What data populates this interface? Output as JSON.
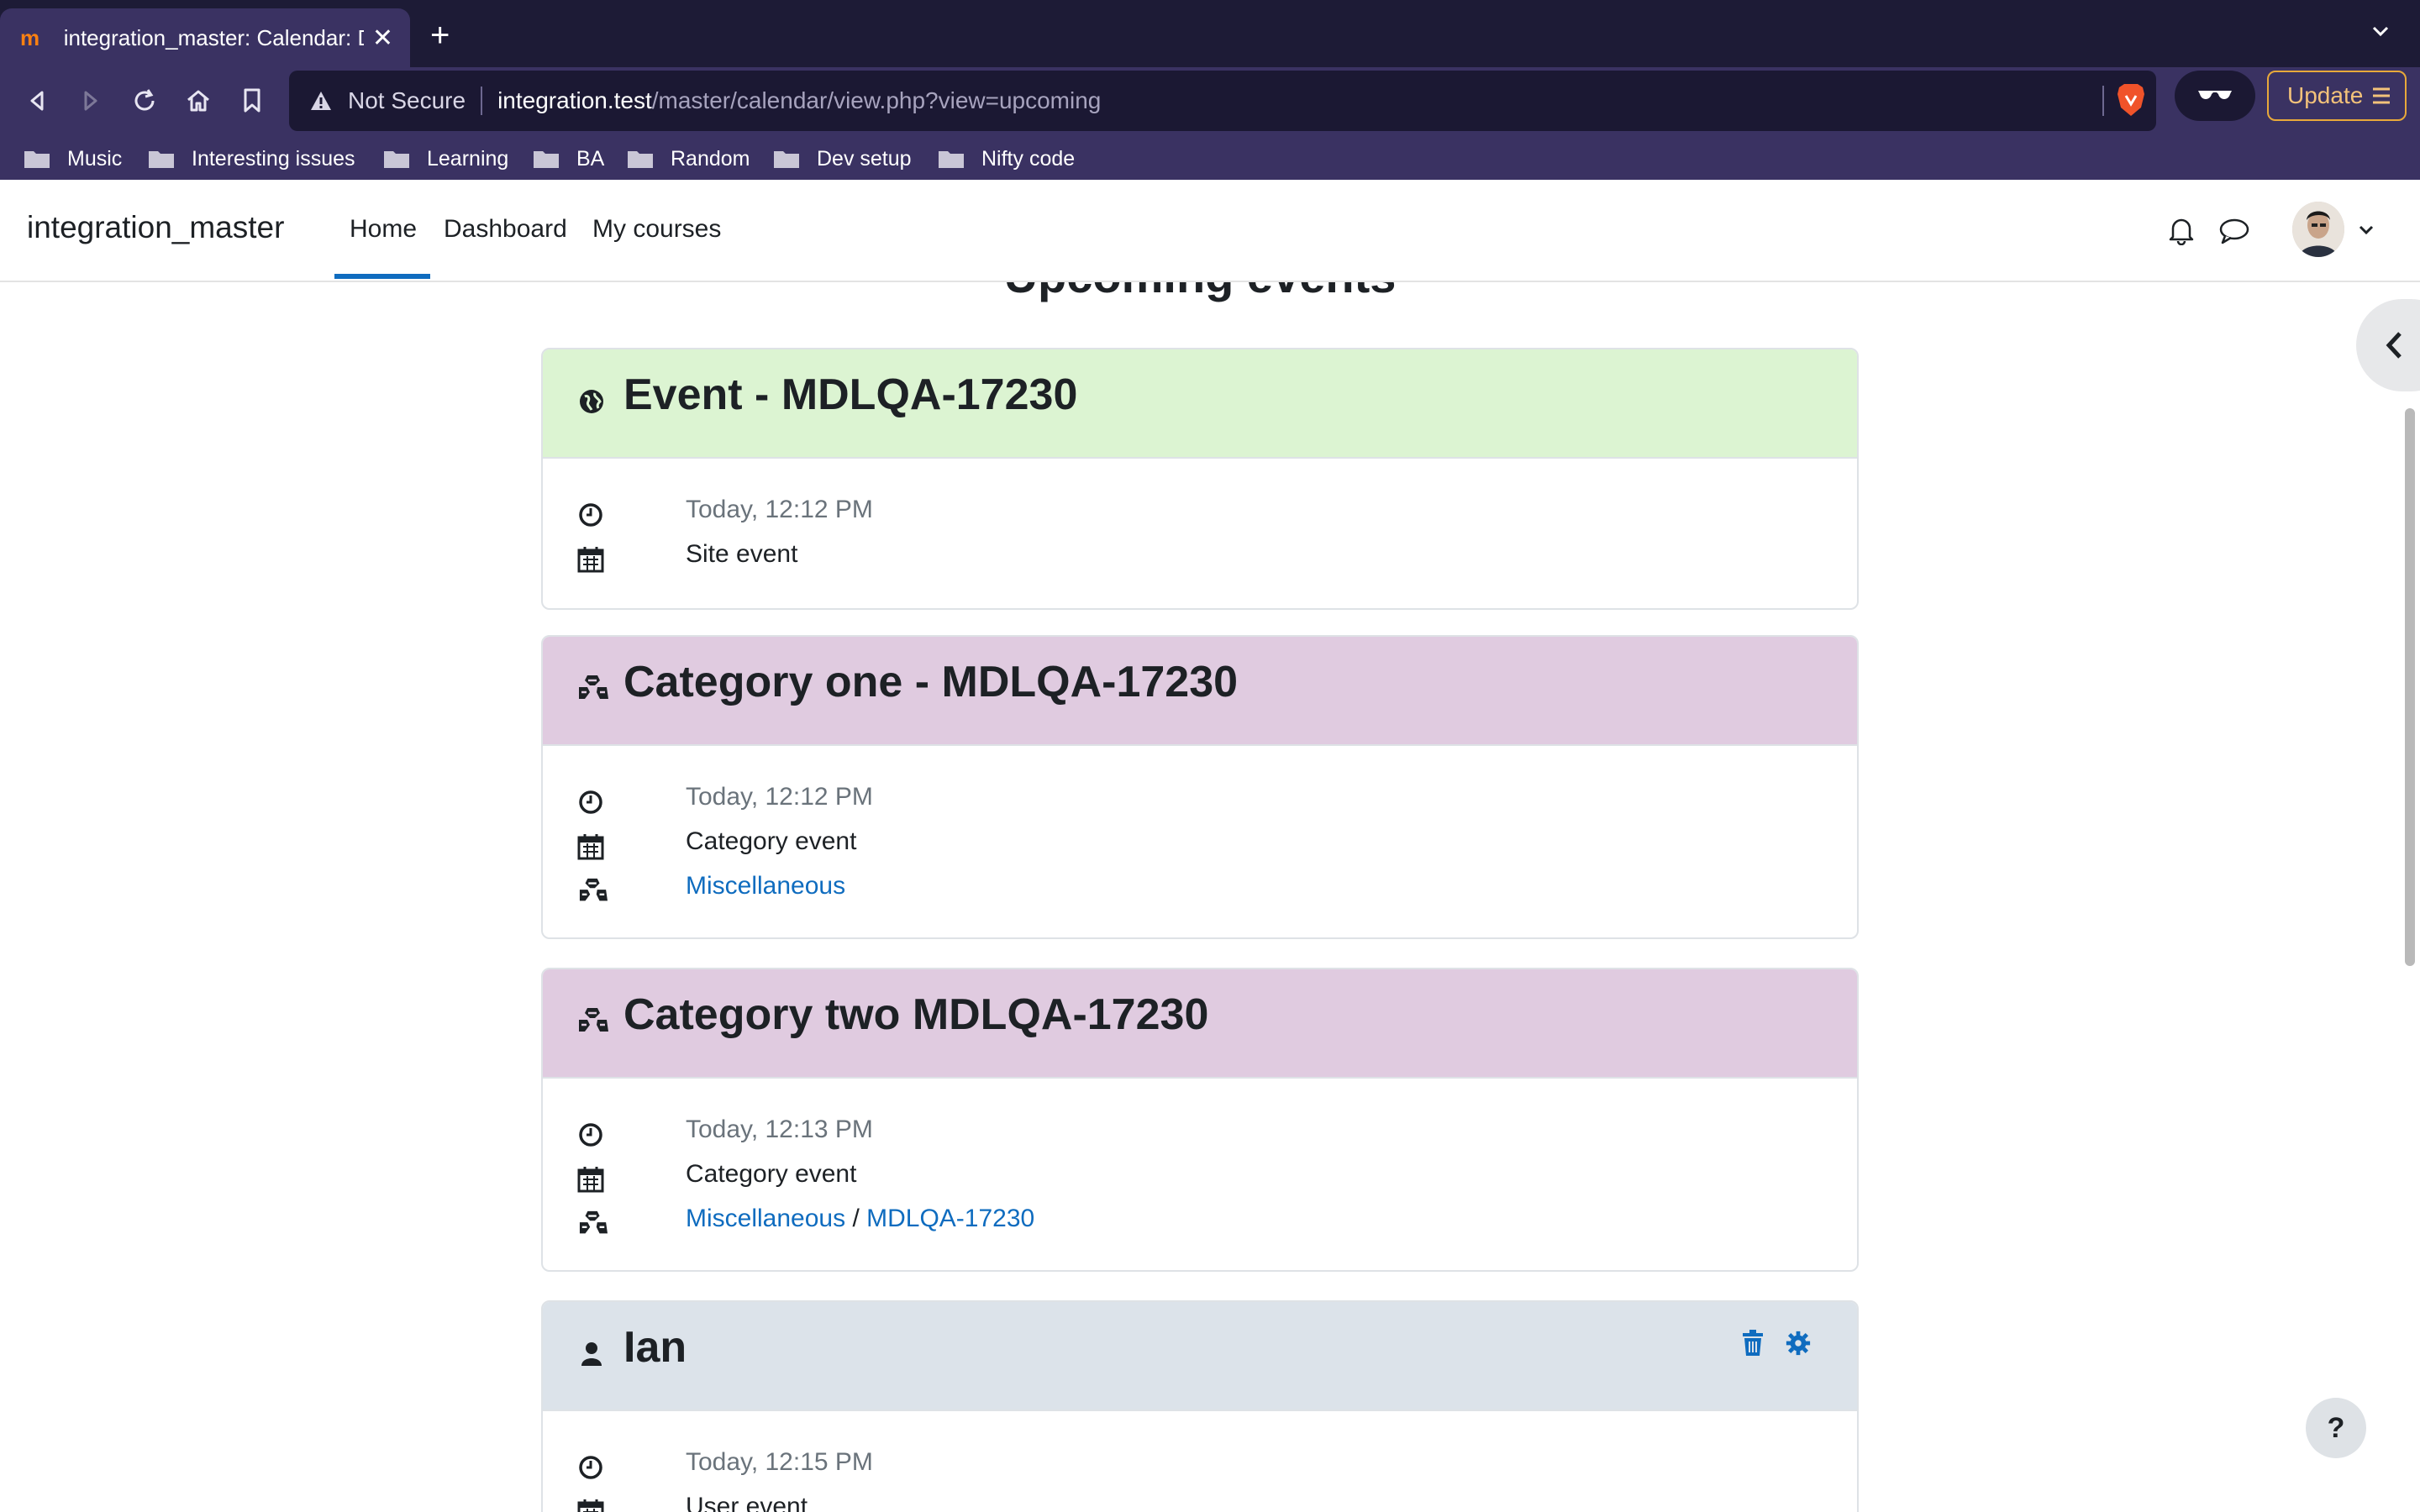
{
  "browser": {
    "tab_title": "integration_master: Calendar: D",
    "url_warning": "Not Secure",
    "url_host": "integration.test",
    "url_path": "/master/calendar/view.php?view=upcoming",
    "update_label": "Update",
    "bookmarks": [
      "Music",
      "Interesting issues",
      "Learning",
      "BA",
      "Random",
      "Dev setup",
      "Nifty code"
    ]
  },
  "site": {
    "brand": "integration_master",
    "nav": [
      "Home",
      "Dashboard",
      "My courses"
    ],
    "active_nav": "Home"
  },
  "page": {
    "heading": "Upcoming events",
    "help_label": "?"
  },
  "events": [
    {
      "title": "Event - MDLQA-17230",
      "type_icon": "globe-icon",
      "color": "#dcf4d2",
      "time": "Today, 12:12 PM",
      "event_type": "Site event"
    },
    {
      "title": "Category one - MDLQA-17230",
      "type_icon": "cubes-icon",
      "color": "#e0cbe0",
      "time": "Today, 12:12 PM",
      "event_type": "Category event",
      "links": [
        "Miscellaneous"
      ]
    },
    {
      "title": "Category two MDLQA-17230",
      "type_icon": "cubes-icon",
      "color": "#e0cbe0",
      "time": "Today, 12:13 PM",
      "event_type": "Category event",
      "links": [
        "Miscellaneous",
        "MDLQA-17230"
      ],
      "separator": "/"
    },
    {
      "title": "Ian",
      "type_icon": "user-icon",
      "color": "#dce3ea",
      "time": "Today, 12:15 PM",
      "event_type": "User event"
    }
  ],
  "colors": {
    "accent": "#0f6cbf",
    "browser_bg": "#3a3262",
    "update_border": "#e8a93a"
  }
}
